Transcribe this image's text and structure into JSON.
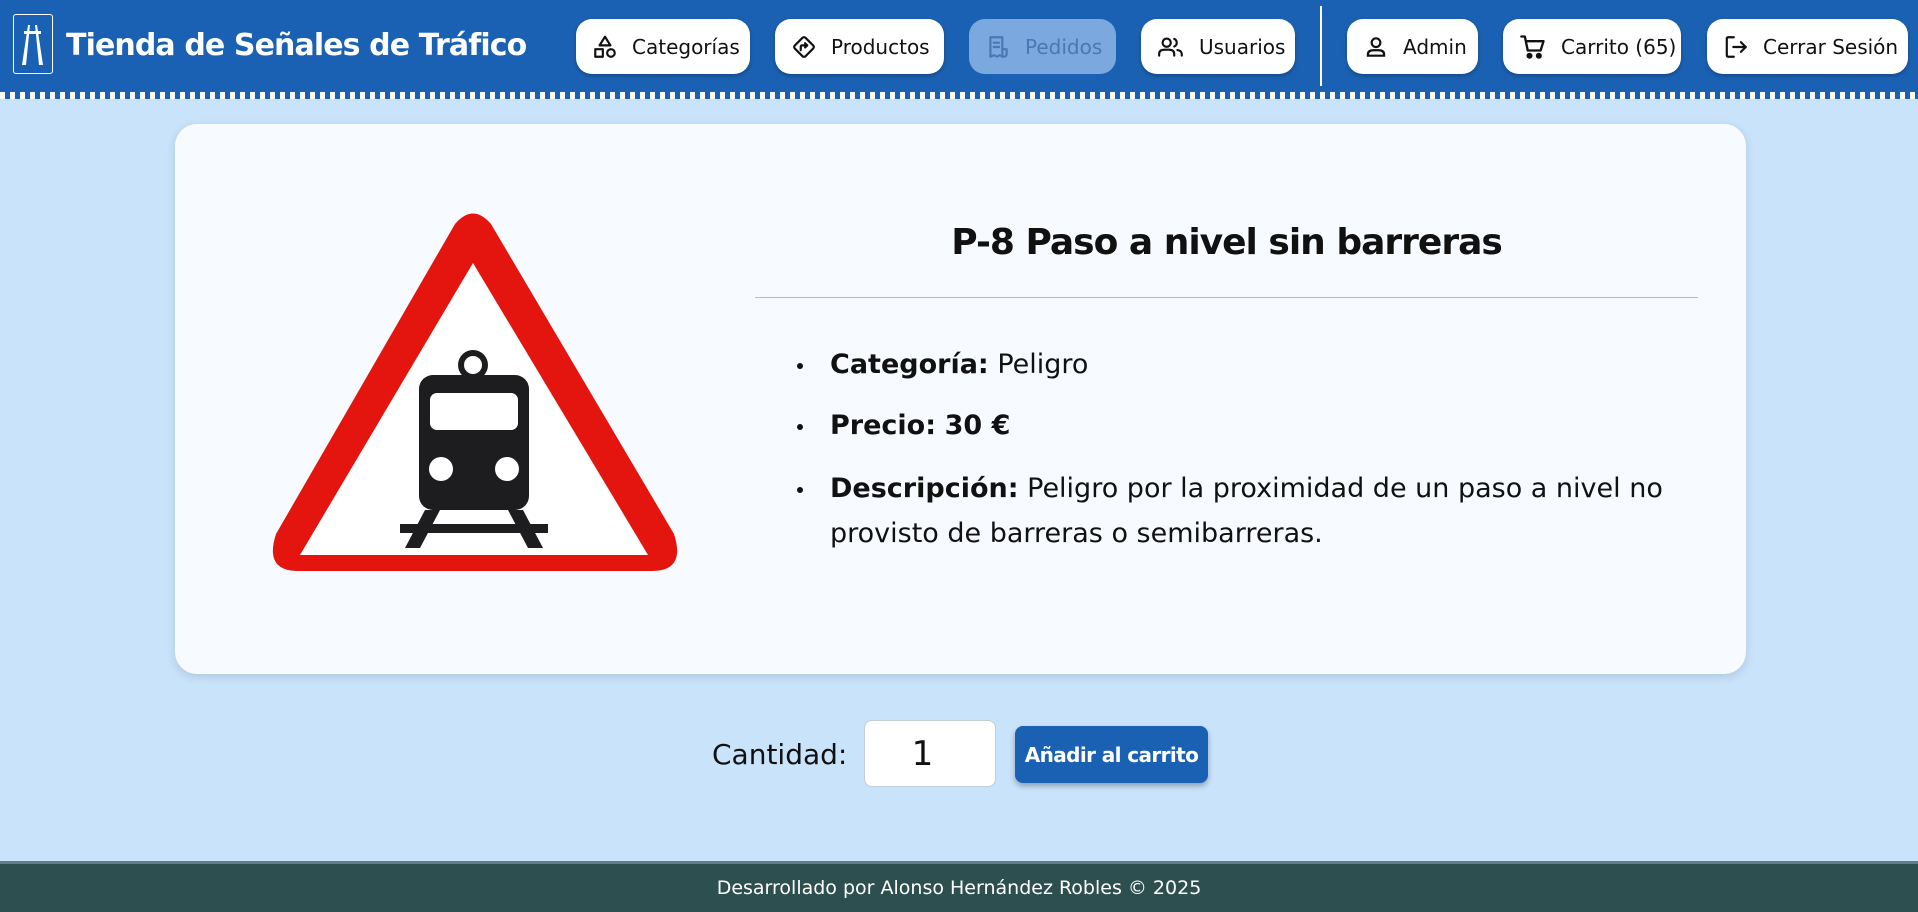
{
  "header": {
    "brand": "Tienda de Señales de Tráfico",
    "logo_icon": "highway-icon",
    "nav": [
      {
        "label": "Categorías",
        "icon": "shapes-icon",
        "disabled": false
      },
      {
        "label": "Productos",
        "icon": "road-sign-icon",
        "disabled": false
      },
      {
        "label": "Pedidos",
        "icon": "receipt-icon",
        "disabled": true
      },
      {
        "label": "Usuarios",
        "icon": "users-icon",
        "disabled": false
      }
    ],
    "user_nav": [
      {
        "label": "Admin",
        "icon": "user-icon"
      },
      {
        "label": "Carrito (65)",
        "icon": "cart-icon"
      },
      {
        "label": "Cerrar Sesión",
        "icon": "logout-icon"
      }
    ],
    "colors": {
      "primary": "#1b61b3",
      "disabled": "#7aa8df"
    }
  },
  "product": {
    "image_icon": "railway-crossing-warning-sign",
    "title": "P-8 Paso a nivel sin barreras",
    "category_label": "Categoría:",
    "category": "Peligro",
    "price_label": "Precio:",
    "price": "30 €",
    "description_label": "Descripción:",
    "description": "Peligro por la proximidad de un paso a nivel no provisto de barreras o semibarreras.",
    "sign_colors": {
      "border": "#e3150e",
      "fill": "#ffffff",
      "symbol": "#1d1d1f"
    }
  },
  "purchase": {
    "quantity_label": "Cantidad:",
    "quantity": "1",
    "add_button": "Añadir al carrito"
  },
  "footer": {
    "text": "Desarrollado por Alonso Hernández Robles © 2025",
    "color": "#2e4f50"
  }
}
